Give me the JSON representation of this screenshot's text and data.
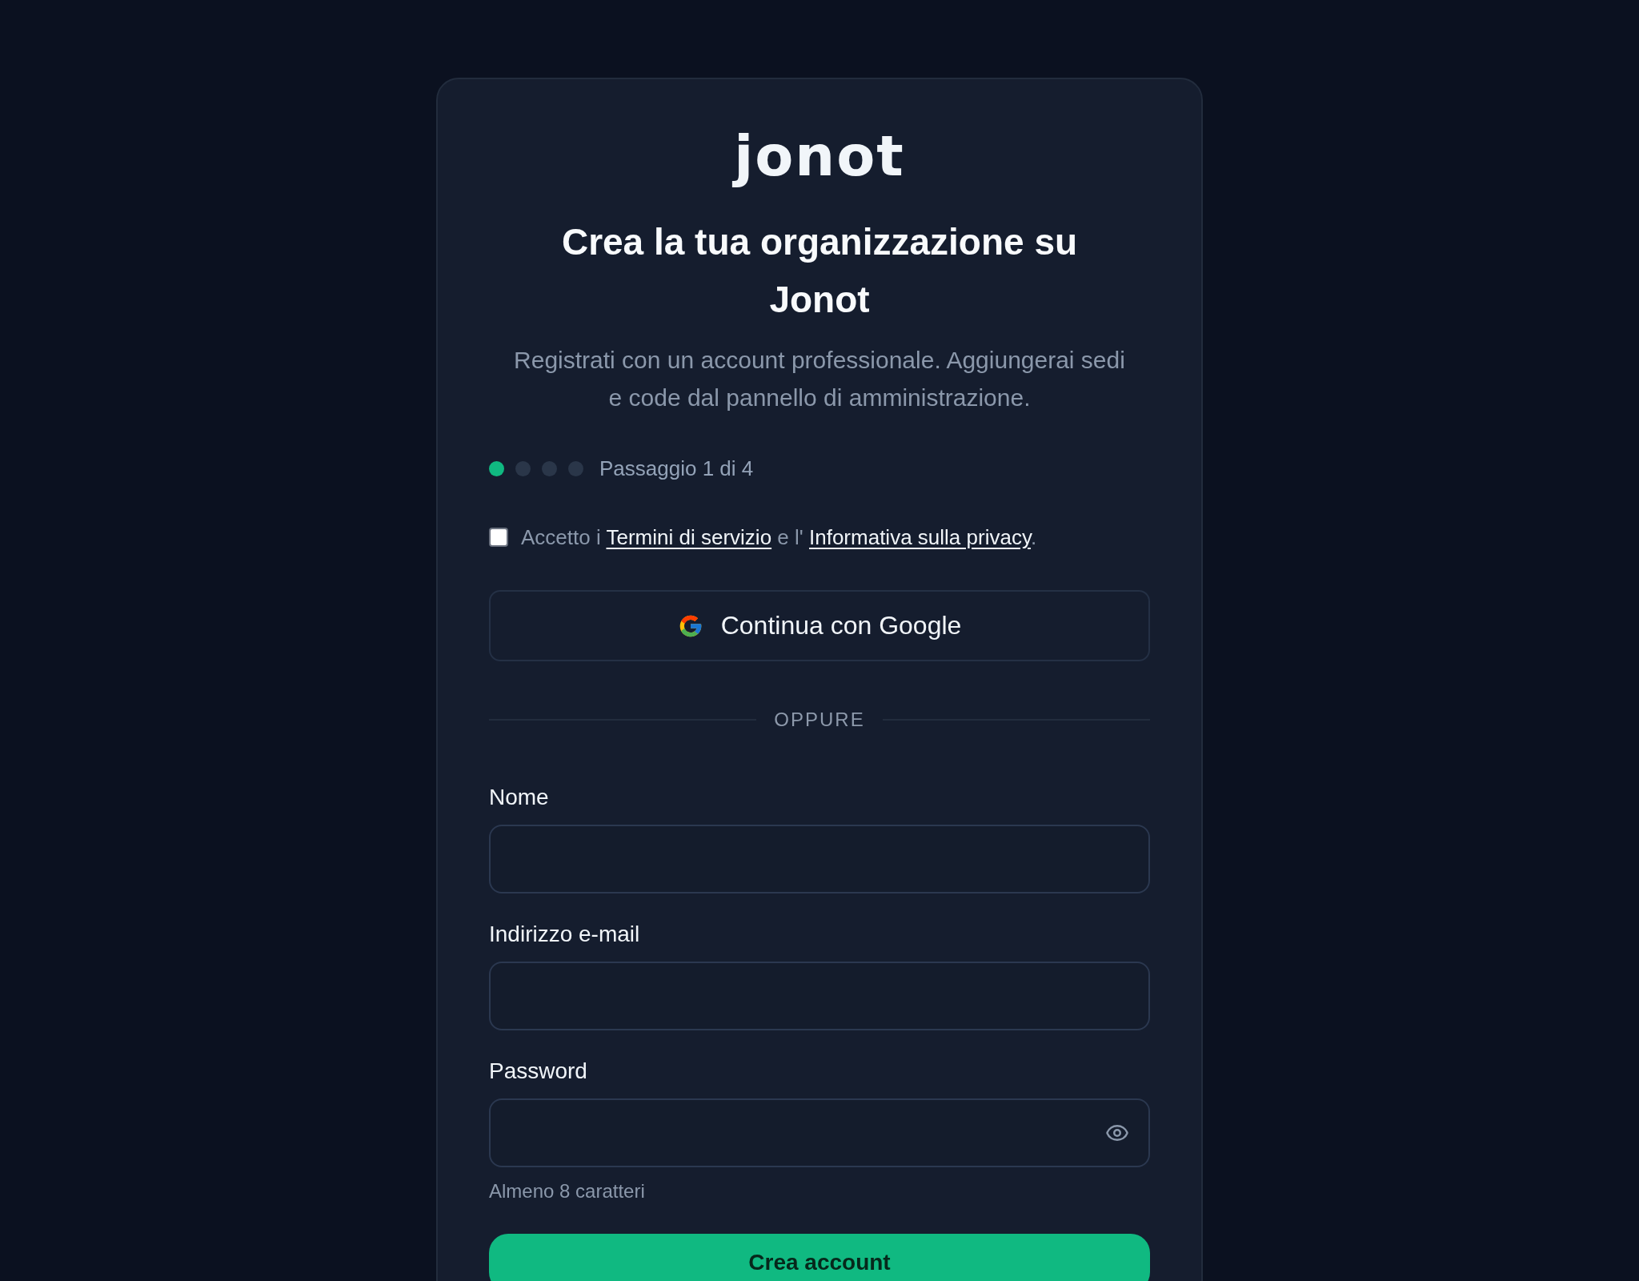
{
  "logo": {
    "text": "jonot"
  },
  "header": {
    "title": "Crea la tua organizzazione su Jonot",
    "subtitle": "Registrati con un account professionale. Aggiungerai sedi e code dal pannello di amministrazione."
  },
  "progress": {
    "steps": [
      {
        "selected": true
      },
      {
        "selected": false
      },
      {
        "selected": false
      },
      {
        "selected": false
      }
    ],
    "label": "Passaggio 1 di 4"
  },
  "terms": {
    "checked": false,
    "parts": [
      {
        "kind": "text",
        "text": "Accetto i"
      },
      {
        "kind": "link",
        "text": "Termini di servizio"
      },
      {
        "kind": "text",
        "text": "e l'"
      },
      {
        "kind": "link",
        "text": "Informativa sulla privacy"
      },
      {
        "kind": "punct",
        "text": "."
      }
    ]
  },
  "google_button": {
    "label": "Continua con Google"
  },
  "divider": {
    "label": "OPPURE"
  },
  "fields": [
    {
      "kind": "text",
      "label": "Nome"
    },
    {
      "kind": "email",
      "label": "Indirizzo e-mail"
    },
    {
      "kind": "password",
      "label": "Password",
      "hint": "Almeno 8 caratteri"
    }
  ],
  "submit_button": {
    "label": "Crea account"
  }
}
